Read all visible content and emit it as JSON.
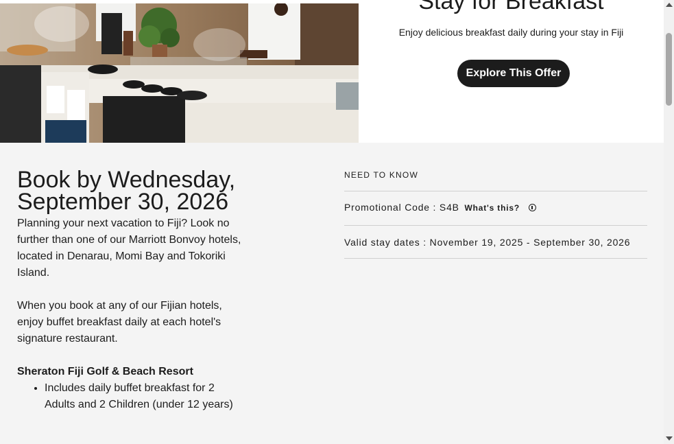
{
  "hero": {
    "title": "Stay for Breakfast",
    "subtitle": "Enjoy delicious breakfast daily during your stay in Fiji",
    "cta_label": "Explore This Offer"
  },
  "offer": {
    "book_by": "Book by Wednesday, September 30, 2026",
    "paragraphs": [
      "Planning your next vacation to Fiji? Look no further than one of our Marriott Bonvoy hotels, located in Denarau, Momi Bay and Tokoriki Island.",
      "When you book at any of our Fijian hotels, enjoy buffet breakfast daily at each hotel's signature restaurant."
    ],
    "resort_name": "Sheraton Fiji Golf & Beach Resort",
    "resort_bullets": [
      "Includes daily buffet breakfast for 2 Adults and 2 Children (under 12 years)"
    ]
  },
  "need_to_know": {
    "heading": "NEED TO KNOW",
    "promo_text": "Promotional Code : S4B",
    "whats_this": "What's this?",
    "valid_text": "Valid stay dates : November 19, 2025 - September 30, 2026"
  },
  "icons": {
    "info": "info-circle-icon"
  },
  "colors": {
    "button_bg": "#1c1c1c",
    "details_bg": "#f4f4f4",
    "text": "#1c1c1c"
  }
}
